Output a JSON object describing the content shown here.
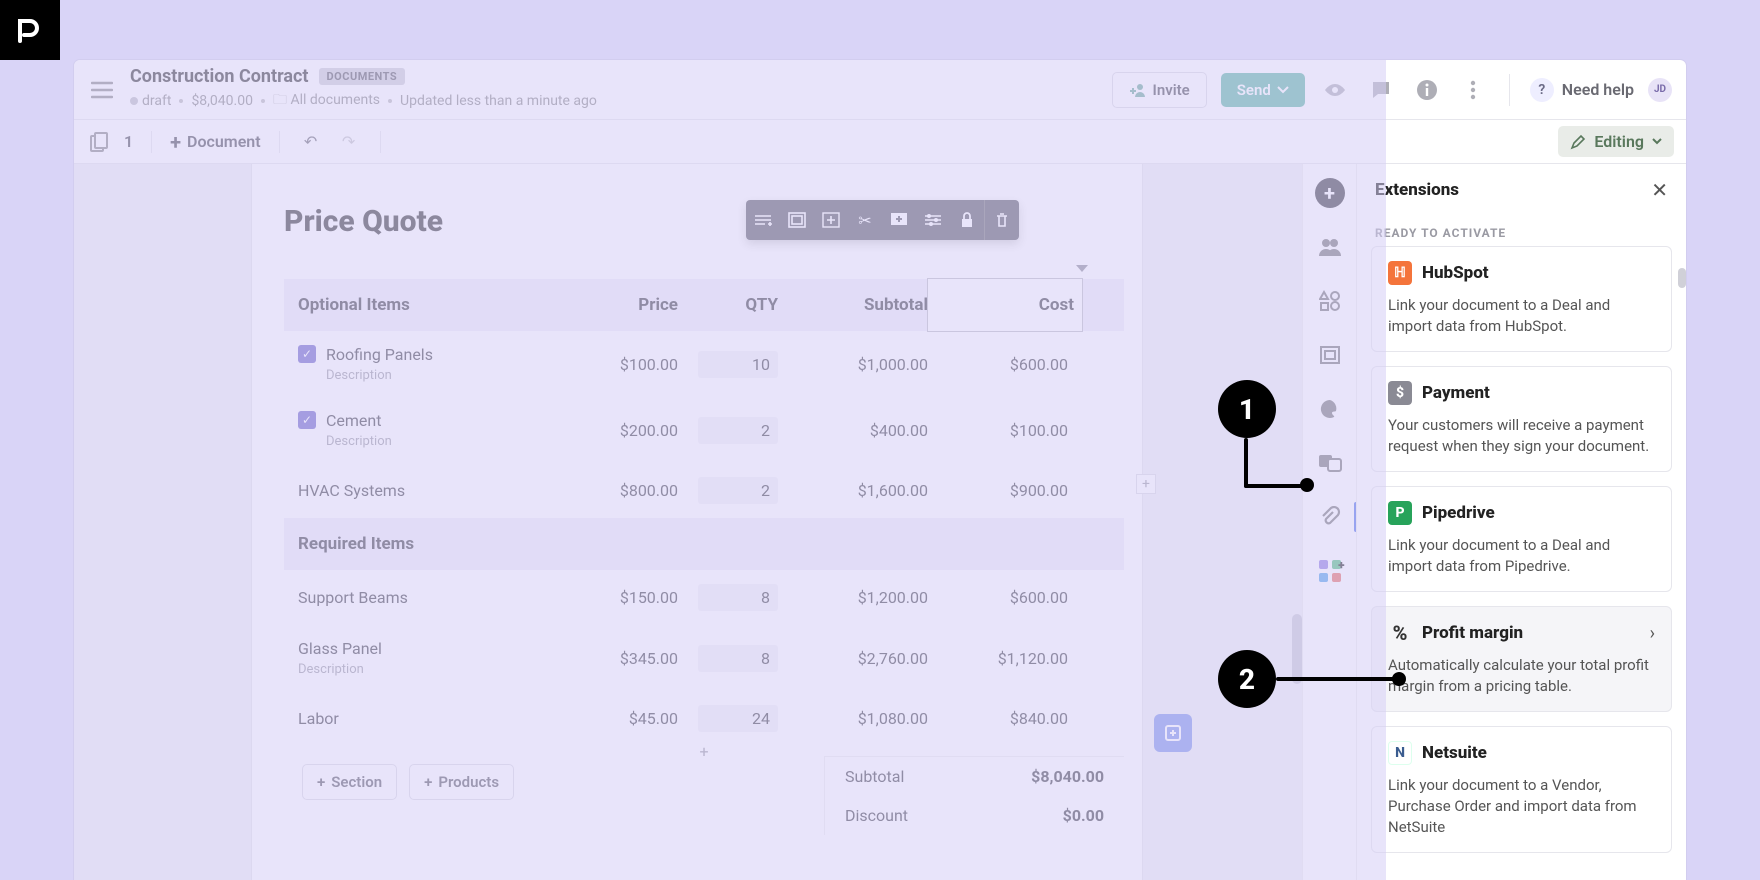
{
  "header": {
    "title": "Construction Contract",
    "tag": "DOCUMENTS",
    "status": "draft",
    "amount": "$8,040.00",
    "folder": "All documents",
    "updated": "Updated less than a minute ago",
    "invite": "Invite",
    "send": "Send",
    "help": "Need help",
    "avatar": "JD"
  },
  "toolbar": {
    "page_count": "1",
    "add_document": "Document",
    "editing": "Editing"
  },
  "document": {
    "heading": "Price Quote",
    "columns": {
      "optional": "Optional Items",
      "required": "Required Items",
      "price": "Price",
      "qty": "QTY",
      "subtotal": "Subtotal",
      "cost": "Cost"
    },
    "optional": [
      {
        "name": "Roofing Panels",
        "checked": true,
        "desc": "Description",
        "price": "$100.00",
        "qty": "10",
        "subtotal": "$1,000.00",
        "cost": "$600.00"
      },
      {
        "name": "Cement",
        "checked": true,
        "desc": "Description",
        "price": "$200.00",
        "qty": "2",
        "subtotal": "$400.00",
        "cost": "$100.00"
      },
      {
        "name": "HVAC Systems",
        "checked": false,
        "desc": "",
        "price": "$800.00",
        "qty": "2",
        "subtotal": "$1,600.00",
        "cost": "$900.00"
      }
    ],
    "required": [
      {
        "name": "Support Beams",
        "desc": "",
        "price": "$150.00",
        "qty": "8",
        "subtotal": "$1,200.00",
        "cost": "$600.00"
      },
      {
        "name": "Glass Panel",
        "desc": "Description",
        "price": "$345.00",
        "qty": "8",
        "subtotal": "$2,760.00",
        "cost": "$1,120.00"
      },
      {
        "name": "Labor",
        "desc": "",
        "price": "$45.00",
        "qty": "24",
        "subtotal": "$1,080.00",
        "cost": "$840.00"
      }
    ],
    "add_section": "Section",
    "add_products": "Products",
    "totals": {
      "subtotal_label": "Subtotal",
      "subtotal_value": "$8,040.00",
      "discount_label": "Discount",
      "discount_value": "$0.00"
    }
  },
  "extensions": {
    "title": "Extensions",
    "ready": "READY TO ACTIVATE",
    "cards": [
      {
        "name": "HubSpot",
        "desc": "Link your document to a Deal and import data from HubSpot.",
        "color": "#f4743b"
      },
      {
        "name": "Payment",
        "desc": "Your customers will receive a payment request when they sign your document.",
        "color": "#8a8a94"
      },
      {
        "name": "Pipedrive",
        "desc": "Link your document to a Deal and import data from Pipedrive.",
        "color": "#27a35a"
      },
      {
        "name": "Profit margin",
        "desc": "Automatically calculate your total profit margin from a pricing table.",
        "color": "#555",
        "active": true
      },
      {
        "name": "Netsuite",
        "desc": "Link your document to a Vendor, Purchase Order and import data from NetSuite",
        "color": "#3a5c8f"
      }
    ]
  },
  "annotations": {
    "one": "1",
    "two": "2"
  }
}
